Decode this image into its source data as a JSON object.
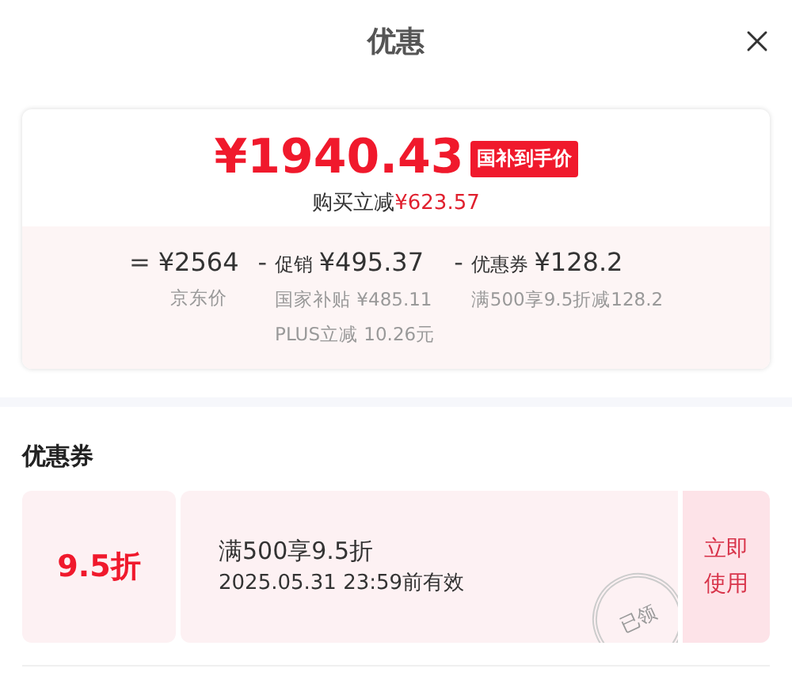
{
  "title": "优惠",
  "price": {
    "value": "¥1940.43",
    "badge": "国补到手价",
    "savings_label": "购买立减",
    "savings_value": "¥623.57"
  },
  "breakdown": [
    {
      "operator": "=",
      "amount": "¥2564",
      "notes": [
        "京东价"
      ]
    },
    {
      "operator": "-",
      "label": "促销",
      "amount": "¥495.37",
      "notes": [
        "国家补贴 ¥485.11",
        "PLUS立减 10.26元"
      ]
    },
    {
      "operator": "-",
      "label": "优惠券",
      "amount": "¥128.2",
      "notes": [
        "满500享9.5折减128.2"
      ]
    }
  ],
  "coupons_heading": "优惠券",
  "coupons": [
    {
      "discount": "9.5折",
      "condition": "满500享9.5折",
      "validity": "2025.05.31 23:59前有效",
      "stamp": "已领",
      "action": "立即使用"
    }
  ]
}
